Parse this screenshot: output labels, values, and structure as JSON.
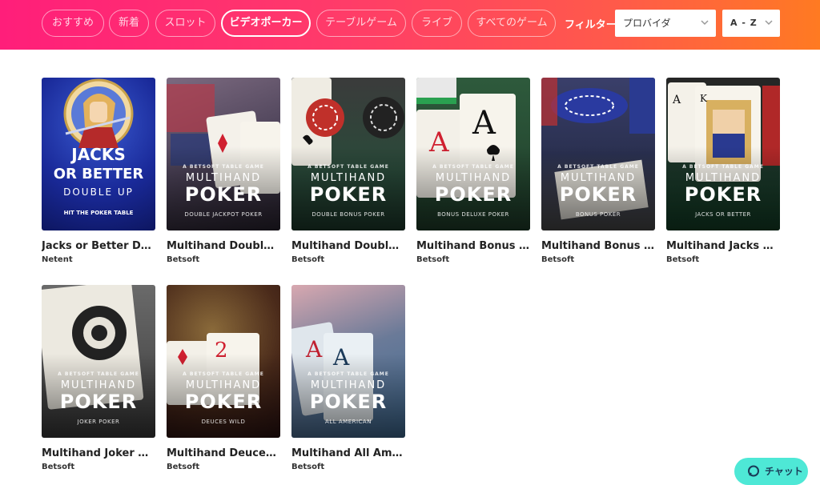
{
  "nav": {
    "tabs": [
      {
        "label": "おすすめ"
      },
      {
        "label": "新着"
      },
      {
        "label": "スロット"
      },
      {
        "label": "ビデオポーカー"
      },
      {
        "label": "テーブルゲーム"
      },
      {
        "label": "ライブ"
      },
      {
        "label": "すべてのゲーム"
      }
    ],
    "active_tab": "ビデオポーカー",
    "filter_label": "フィルター",
    "provider_select": "プロバイダ",
    "sort_select": "A - Z"
  },
  "games": [
    {
      "name": "Jacks or Better Double Up",
      "provider": "Netent",
      "art": {
        "line1": "JACKS",
        "line2": "OR BETTER",
        "line3": "DOUBLE UP",
        "line4": "HIT THE POKER TABLE"
      }
    },
    {
      "name": "Multihand Double Jackpot Poker",
      "provider": "Betsoft",
      "art": {
        "sub": "A BETSOFT TABLE GAME",
        "multi": "MULTIHAND",
        "poker": "POKER",
        "variant": "DOUBLE JACKPOT POKER"
      }
    },
    {
      "name": "Multihand Double Bonus Poker",
      "provider": "Betsoft",
      "art": {
        "sub": "A BETSOFT TABLE GAME",
        "multi": "MULTIHAND",
        "poker": "POKER",
        "variant": "DOUBLE BONUS POKER"
      }
    },
    {
      "name": "Multihand Bonus Deluxe Poker",
      "provider": "Betsoft",
      "art": {
        "sub": "A BETSOFT TABLE GAME",
        "multi": "MULTIHAND",
        "poker": "POKER",
        "variant": "BONUS DELUXE POKER"
      }
    },
    {
      "name": "Multihand Bonus Poker",
      "provider": "Betsoft",
      "art": {
        "sub": "A BETSOFT TABLE GAME",
        "multi": "MULTIHAND",
        "poker": "POKER",
        "variant": "BONUS POKER"
      }
    },
    {
      "name": "Multihand Jacks Or Better",
      "provider": "Betsoft",
      "art": {
        "sub": "A BETSOFT TABLE GAME",
        "multi": "MULTIHAND",
        "poker": "POKER",
        "variant": "JACKS OR BETTER"
      }
    },
    {
      "name": "Multihand Joker Poker",
      "provider": "Betsoft",
      "art": {
        "sub": "A BETSOFT TABLE GAME",
        "multi": "MULTIHAND",
        "poker": "POKER",
        "variant": "JOKER POKER"
      }
    },
    {
      "name": "Multihand Deuces Wild",
      "provider": "Betsoft",
      "art": {
        "sub": "A BETSOFT TABLE GAME",
        "multi": "MULTIHAND",
        "poker": "POKER",
        "variant": "DEUCES WILD"
      }
    },
    {
      "name": "Multihand All American",
      "provider": "Betsoft",
      "art": {
        "sub": "A BETSOFT TABLE GAME",
        "multi": "MULTIHAND",
        "poker": "POKER",
        "variant": "ALL AMERICAN"
      }
    }
  ],
  "chat": {
    "label": "チャット"
  }
}
